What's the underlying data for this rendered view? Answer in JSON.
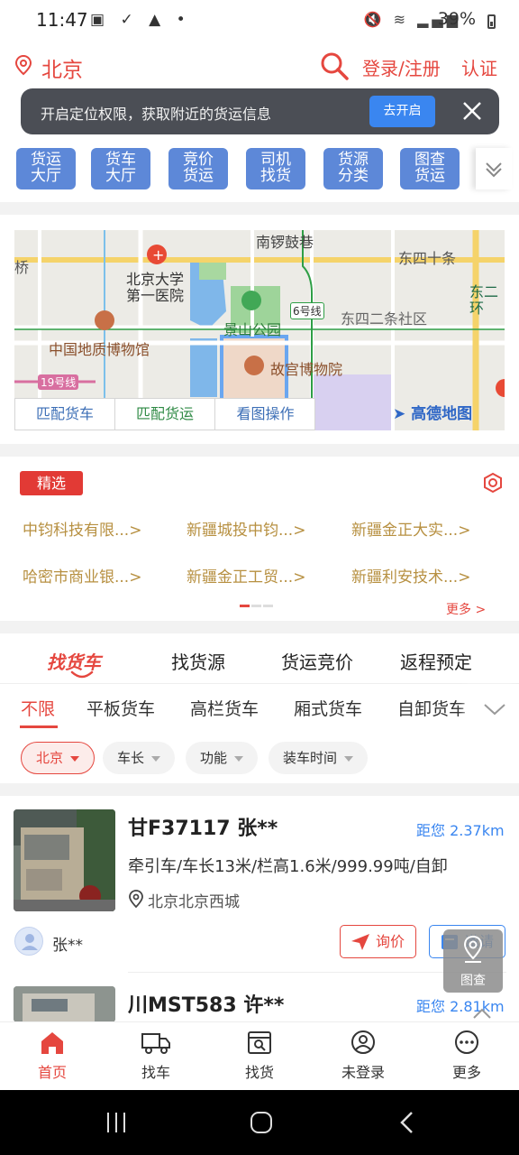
{
  "status_bar": {
    "time": "11:47",
    "battery": "39%"
  },
  "header": {
    "city": "北京",
    "login": "登录/注册",
    "verify": "认证"
  },
  "location_banner": {
    "text": "开启定位权限，获取附近的货运信息",
    "button": "去开启"
  },
  "quick_buttons": [
    {
      "l1": "货运",
      "l2": "大厅"
    },
    {
      "l1": "货车",
      "l2": "大厅"
    },
    {
      "l1": "竞价",
      "l2": "货运"
    },
    {
      "l1": "司机",
      "l2": "找货"
    },
    {
      "l1": "货源",
      "l2": "分类"
    },
    {
      "l1": "图查",
      "l2": "货运"
    }
  ],
  "map": {
    "labels": {
      "road1": "南锣鼓巷",
      "road2": "东四十条",
      "hospital": "北京大学\n第一医院",
      "park": "景山公园",
      "line6": "6号线",
      "community": "东四二条社区",
      "east2": "东二\n环",
      "museum_geo": "中国地质博物馆",
      "palace": "故宫博物院",
      "line19": "19号线",
      "bridge": "桥"
    },
    "tabs": [
      "匹配货车",
      "匹配货运",
      "看图操作"
    ],
    "provider": "高德地图"
  },
  "featured": {
    "tag": "精选",
    "items": [
      "中钧科技有限...>",
      "新疆城投中钧...>",
      "新疆金正大实...>",
      "哈密市商业银...>",
      "新疆金正工贸...>",
      "新疆利安技术...>"
    ],
    "more": "更多 >"
  },
  "main_tabs": [
    "找货车",
    "找货源",
    "货运竞价",
    "返程预定"
  ],
  "vehicle_tabs": [
    "不限",
    "平板货车",
    "高栏货车",
    "厢式货车",
    "自卸货车"
  ],
  "filters": [
    "北京",
    "车长",
    "功能",
    "装车时间"
  ],
  "listings": [
    {
      "plate": "甘F37117 张**",
      "distance": "距您 2.37km",
      "specs": "牵引车/车长13米/栏高1.6米/999.99吨/自卸",
      "address": "北京北京西城",
      "owner": "张**",
      "inquire": "询价",
      "invite": "邀请"
    },
    {
      "plate": "川MST583 许**",
      "distance": "距您 2.81km"
    }
  ],
  "float_button": "图查",
  "bottom_nav": [
    "首页",
    "找车",
    "找货",
    "未登录",
    "更多"
  ],
  "colors": {
    "accent": "#e5473f",
    "blue": "#3a86f0",
    "quick_button": "#5d88d8"
  }
}
